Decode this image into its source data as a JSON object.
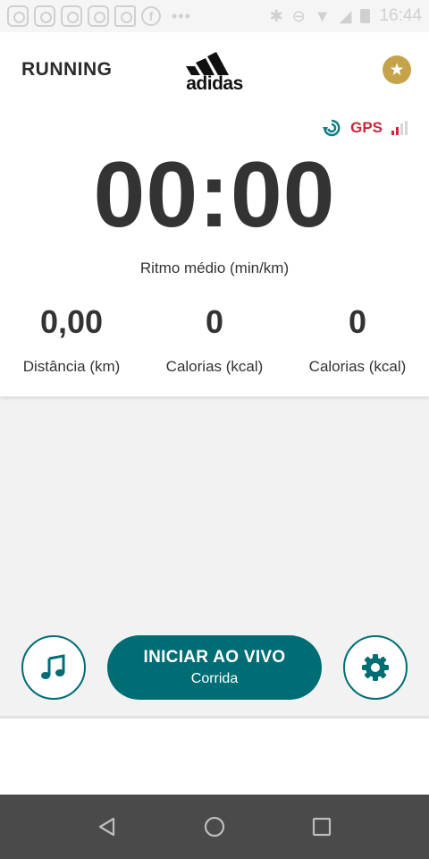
{
  "status_bar": {
    "time": "16:44",
    "dots": "•••"
  },
  "header": {
    "title": "RUNNING",
    "logo_text": "adidas",
    "favorite_icon": "star-icon"
  },
  "gps": {
    "label": "GPS",
    "signal_bars": 4,
    "signal_active": 2,
    "color": "#c8283a"
  },
  "timer": {
    "value": "00:00",
    "label": "Ritmo médio (min/km)"
  },
  "stats": [
    {
      "value": "0,00",
      "label": "Distância (km)"
    },
    {
      "value": "0",
      "label": "Calorias (kcal)"
    },
    {
      "value": "0",
      "label": "Calorias (kcal)"
    }
  ],
  "controls": {
    "music_icon": "music-note-icon",
    "start_title": "INICIAR AO VIVO",
    "start_subtitle": "Corrida",
    "settings_icon": "gear-icon",
    "accent": "#006d75"
  },
  "nav": {
    "back_icon": "back-icon",
    "home_icon": "home-icon",
    "recents_icon": "recents-icon"
  }
}
